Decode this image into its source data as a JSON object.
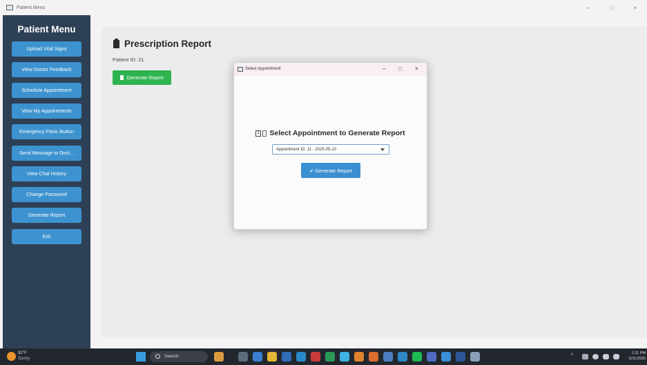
{
  "window": {
    "title": "Patient Menu",
    "minimize": "–",
    "maximize": "□",
    "close": "×"
  },
  "sidebar": {
    "title": "Patient Menu",
    "items": [
      {
        "label": "Upload Vital Signs"
      },
      {
        "label": "View Doctor Feedback"
      },
      {
        "label": "Schedule Appointment"
      },
      {
        "label": "View My Appointments"
      },
      {
        "label": "Emergency Panic Button"
      },
      {
        "label": "Send Message to Doct..."
      },
      {
        "label": "View Chat History"
      },
      {
        "label": "Change Password"
      },
      {
        "label": "Generate Report"
      },
      {
        "label": "Exit"
      }
    ]
  },
  "main": {
    "title": "Prescription Report",
    "patient_id": "Patient ID: 21",
    "generate_button": "Generate Report"
  },
  "dialog": {
    "title": "Select Appointment",
    "minimize": "–",
    "maximize": "□",
    "close": "×",
    "heading_digit": "1",
    "heading": "Select Appointment to Generate Report",
    "select_value": "Appointment ID: 11 - 2025-05-10",
    "button": "✔ Generate Report"
  },
  "taskbar": {
    "weather_temp": "92°F",
    "weather_desc": "Sunny",
    "search_label": "Search",
    "tray_symbols": "^",
    "time": "1:21 PM",
    "date": "5/11/2025"
  },
  "colors": {
    "sidebar_bg": "#2e4055",
    "sidebar_button": "#3d93cf",
    "main_green_button": "#2eb44f",
    "dialog_button": "#3a8fd0"
  }
}
